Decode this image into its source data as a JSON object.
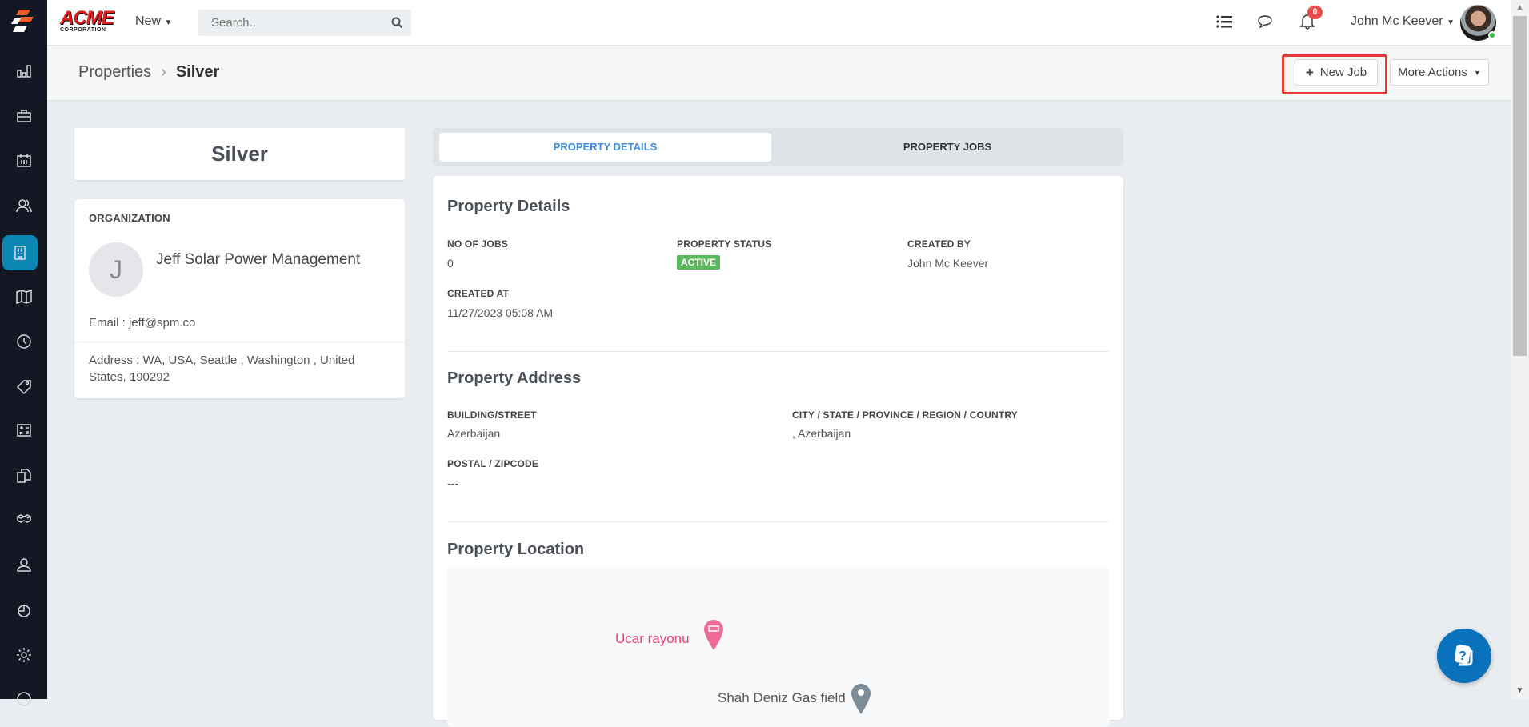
{
  "brand": {
    "logo_text": "ACME",
    "logo_sub": "CORPORATION"
  },
  "topbar": {
    "new_label": "New",
    "search_placeholder": "Search..",
    "notification_count": "0",
    "user_name": "John Mc Keever"
  },
  "breadcrumb": {
    "parent": "Properties",
    "separator": "›",
    "current": "Silver"
  },
  "actions": {
    "new_job": "New Job",
    "more_actions": "More Actions"
  },
  "sidebar": {
    "items": [
      "reports",
      "jobs",
      "calendar",
      "customers",
      "properties",
      "map",
      "timesheets",
      "tags",
      "estimates",
      "documents",
      "inventory",
      "users",
      "time",
      "settings",
      "help"
    ],
    "active": "properties"
  },
  "property_card": {
    "title": "Silver"
  },
  "organization": {
    "heading": "ORGANIZATION",
    "initial": "J",
    "name": "Jeff Solar Power Management",
    "email": "Email : jeff@spm.co",
    "address": "Address : WA, USA, Seattle , Washington , United States, 190292"
  },
  "tabs": [
    {
      "label": "PROPERTY DETAILS",
      "active": true
    },
    {
      "label": "PROPERTY JOBS",
      "active": false
    }
  ],
  "details": {
    "heading": "Property Details",
    "no_of_jobs_label": "NO OF JOBS",
    "no_of_jobs": "0",
    "status_label": "PROPERTY STATUS",
    "status": "ACTIVE",
    "created_by_label": "CREATED BY",
    "created_by": "John Mc Keever",
    "created_at_label": "CREATED AT",
    "created_at": "11/27/2023 05:08 AM"
  },
  "address": {
    "heading": "Property Address",
    "street_label": "BUILDING/STREET",
    "street": "Azerbaijan",
    "city_label": "CITY / STATE / PROVINCE / REGION / COUNTRY",
    "city": ", Azerbaijan",
    "postal_label": "POSTAL / ZIPCODE",
    "postal": "---"
  },
  "location": {
    "heading": "Property Location",
    "places": [
      "Ucar rayonu",
      "Shah Deniz Gas field"
    ]
  },
  "colors": {
    "sidebar": "#141824",
    "active": "#0b86b3",
    "accent": "#3b8fe0",
    "status": "#5cb85c",
    "highlight": "#e53935",
    "help": "#0a72bd"
  }
}
